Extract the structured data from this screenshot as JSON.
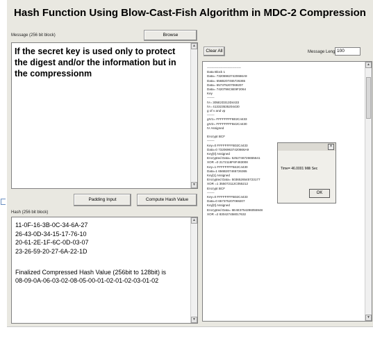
{
  "window": {
    "title": "Hash Function Using Blow-Cast-Fish Algorithm in MDC-2 Compression"
  },
  "message_panel": {
    "label": "Message (256 bit block)",
    "browse_label": "Browse",
    "text": "If the secret key is used only to protect  the digest and/or the information but in the compressionm"
  },
  "buttons": {
    "padding_label": "Padding Input",
    "compute_label": "Compute Hash Value",
    "clear_label": "Clear All"
  },
  "hash_panel": {
    "label": "Hash (256 bit block)",
    "lines": [
      "11-0F-16-3B-0C-34-6A-27",
      "26-43-0D-34-15-17-76-10",
      "20-61-2E-1F-6C-0D-03-07",
      "23-26-59-20-27-6A-22-1D",
      "",
      "Finalized Compressed Hash Value (256bit to 128bit)  is",
      "08-09-0A-06-03-02-08-05-00-01-02-01-02-03-01-02"
    ]
  },
  "length": {
    "label": "Message Length",
    "value": "100"
  },
  "log_panel": {
    "lines": [
      "--------------------------------",
      "Data Block 1",
      "Data=  732069637420666A9",
      "Data=  656B207465726365",
      "Data=  657375207069207",
      "Data=  7420796C6E9F2064",
      "Key",
      "-------",
      "IV=  305E2D313D4433",
      "IV=  413323535204430",
      "g of v and vp",
      "-------",
      "gIV1=  FFFFFFFFB02C4433",
      "gIV2=  FFFFFFFFB42C4430",
      "IV Assigned",
      "",
      "Encrypt BCF",
      "-------",
      "Key=0   FFFFFFFFB02C4433",
      "Data=0   732069637420666A9",
      "Key[0]  Assigned",
      "Encrypted Data=   5252746726655641",
      "XOR =0   2172118F6F483008",
      "Key=1   FFFFFFFFB42C4430",
      "Data=1   656B207465726365",
      "Key[1]  Assigned",
      "Encrypted Data=   5036526545723177",
      "XOR =1   355072112C055212",
      "Encrypt BCF",
      "-------",
      "Key=0   FFFFFFFFB02C4433",
      "Data=0   657375207069207",
      "Key[0]  Assigned",
      "Encrypted Data=   6E4E3754286055948",
      "XOR =2   830427458017632"
    ]
  },
  "dialog": {
    "time_text": "Time= 46.0001 Milli Sec",
    "ok_label": "OK",
    "close_glyph": "×"
  },
  "icons": {
    "arrow_up": "▲",
    "arrow_down": "▼"
  }
}
